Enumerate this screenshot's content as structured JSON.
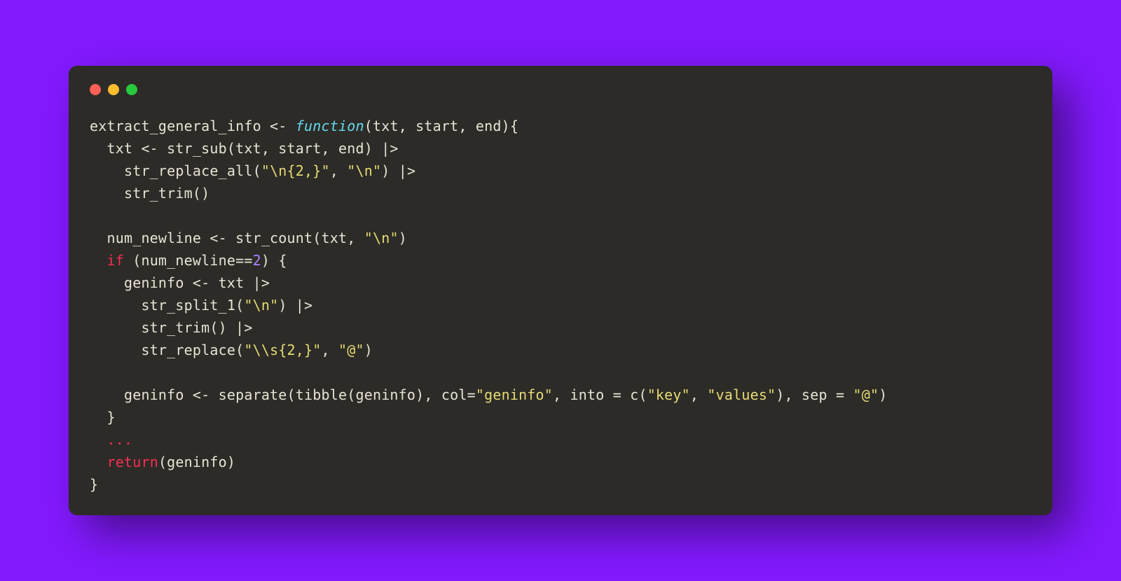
{
  "colors": {
    "background": "#8319ff",
    "editor_bg": "#2c2b27",
    "default": "#e9e3d5",
    "keyword_red": "#f92d55",
    "keyword_blue": "#66d9ef",
    "number": "#ae81ff",
    "string": "#e6db74",
    "traffic_red": "#ff5f56",
    "traffic_yellow": "#ffbd2e",
    "traffic_green": "#27c93f"
  },
  "code": {
    "line1": {
      "t1": "extract_general_info <- ",
      "kw": "function",
      "t2": "(txt, start, end){"
    },
    "line2": {
      "t1": "  txt <- str_sub(txt, start, end) |> "
    },
    "line3": {
      "t1": "    str_replace_all(",
      "s1": "\"\\n{2,}\"",
      "t2": ", ",
      "s2": "\"\\n\"",
      "t3": ") |>"
    },
    "line4": {
      "t1": "    str_trim()"
    },
    "line5": {
      "t1": ""
    },
    "line6": {
      "t1": "  num_newline <- str_count(txt, ",
      "s1": "\"\\n\"",
      "t2": ")"
    },
    "line7": {
      "t1": "  ",
      "kw": "if",
      "t2": " (num_newline==",
      "n1": "2",
      "t3": ") {"
    },
    "line8": {
      "t1": "    geninfo <- txt |> "
    },
    "line9": {
      "t1": "      str_split_1(",
      "s1": "\"\\n\"",
      "t2": ") |> "
    },
    "line10": {
      "t1": "      str_trim() |>"
    },
    "line11": {
      "t1": "      str_replace(",
      "s1": "\"\\\\s{2,}\"",
      "t2": ", ",
      "s2": "\"@\"",
      "t3": ")"
    },
    "line12": {
      "t1": ""
    },
    "line13": {
      "t1": "    geninfo <- separate(tibble(geninfo), col=",
      "s1": "\"geninfo\"",
      "t2": ", into = c(",
      "s2": "\"key\"",
      "t3": ", ",
      "s3": "\"values\"",
      "t4": "), sep = ",
      "s4": "\"@\"",
      "t5": ")"
    },
    "line14": {
      "t1": "  }"
    },
    "line15": {
      "kw": "  ..."
    },
    "line16": {
      "t1": "  ",
      "kw": "return",
      "t2": "(geninfo)"
    },
    "line17": {
      "t1": "}"
    }
  }
}
